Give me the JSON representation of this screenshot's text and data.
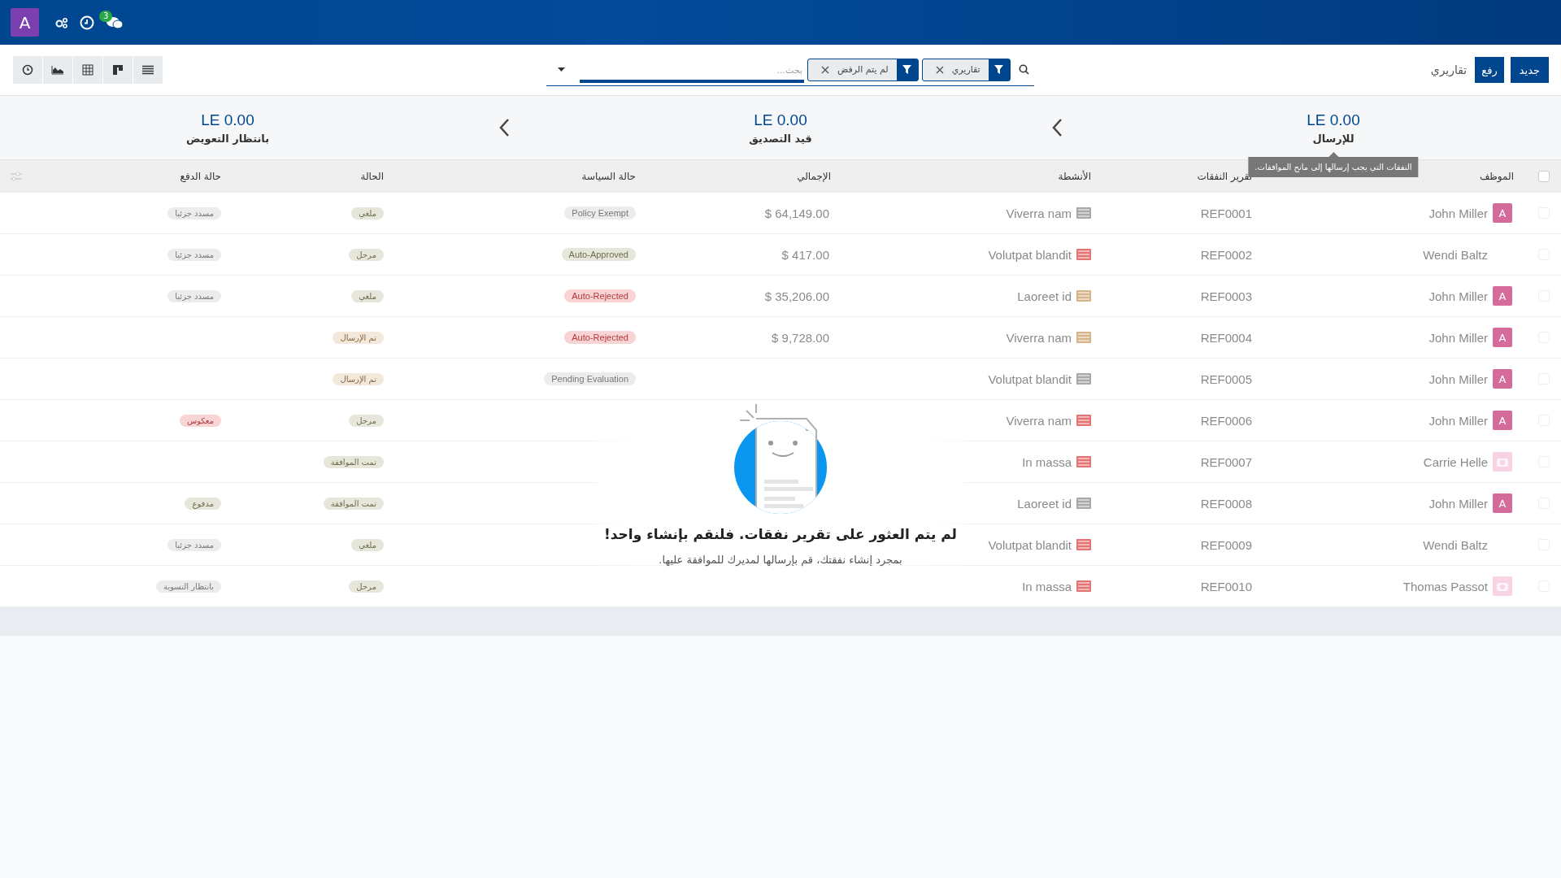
{
  "navbar": {
    "user_initial": "A",
    "messages_badge": "3"
  },
  "control_panel": {
    "buttons": [
      {
        "label": "جديد",
        "kind": "primary"
      },
      {
        "label": "رفع",
        "kind": "upload"
      }
    ],
    "breadcrumb": "تقاريري",
    "search": {
      "facets": [
        {
          "label": "تقاريري"
        },
        {
          "label": "لم يتم الرفض"
        }
      ],
      "placeholder": "بحث..."
    },
    "views": [
      {
        "kind": "activity"
      },
      {
        "kind": "graph"
      },
      {
        "kind": "pivot"
      },
      {
        "kind": "kanban"
      },
      {
        "kind": "list"
      }
    ]
  },
  "summary": [
    {
      "amount": "LE 0.00",
      "label": "للإرسال",
      "tooltip": "النفقات التي يجب إرسالها إلى مانح الموافقات."
    },
    {
      "amount": "LE 0.00",
      "label": "قيد التصديق"
    },
    {
      "amount": "LE 0.00",
      "label": "بانتظار التعويض"
    }
  ],
  "table": {
    "select_all_checked": false,
    "columns": [
      "الموظف",
      "تقرير النفقات",
      "الأنشطة",
      "الإجمالي",
      "حالة السياسة",
      "الحالة",
      "حالة الدفع"
    ],
    "rows": [
      {
        "checked": false,
        "employee": "John Miller",
        "avatar": {
          "kind": "letter",
          "text": "A"
        },
        "reference": "REF0001",
        "activity": "Viverra nam",
        "color": "#a8a8a8",
        "total": "$ 64,149.00",
        "policy": {
          "label": "Policy Exempt",
          "kind": "neutral"
        },
        "status": {
          "label": "ملغي",
          "kind": "olive"
        },
        "payment": {
          "label": "مسدد جزئيا",
          "kind": "neutral"
        }
      },
      {
        "checked": false,
        "employee": "Wendi Baltz",
        "avatar": {
          "kind": "none"
        },
        "reference": "REF0002",
        "activity": "Volutpat blandit",
        "color": "#e57373",
        "total": "$ 417.00",
        "policy": {
          "label": "Auto-Approved",
          "kind": "olive"
        },
        "status": {
          "label": "مرحل",
          "kind": "olive"
        },
        "payment": {
          "label": "مسدد جزئيا",
          "kind": "neutral"
        }
      },
      {
        "checked": false,
        "employee": "John Miller",
        "avatar": {
          "kind": "letter",
          "text": "A"
        },
        "reference": "REF0003",
        "activity": "Laoreet id",
        "color": "#d6b48a",
        "total": "$ 35,206.00",
        "policy": {
          "label": "Auto-Rejected",
          "kind": "red"
        },
        "status": {
          "label": "ملغي",
          "kind": "olive"
        },
        "payment": {
          "label": "مسدد جزئيا",
          "kind": "neutral"
        }
      },
      {
        "checked": false,
        "employee": "John Miller",
        "avatar": {
          "kind": "letter",
          "text": "A"
        },
        "reference": "REF0004",
        "activity": "Viverra nam",
        "color": "#d6b48a",
        "total": "$ 9,728.00",
        "policy": {
          "label": "Auto-Rejected",
          "kind": "red"
        },
        "status": {
          "label": "تم الإرسال",
          "kind": "tan"
        }
      },
      {
        "checked": false,
        "employee": "John Miller",
        "avatar": {
          "kind": "letter",
          "text": "A"
        },
        "reference": "REF0005",
        "activity": "Volutpat blandit",
        "color": "#a8a8a8",
        "policy": {
          "label": "Pending Evaluation",
          "kind": "neutral"
        },
        "status": {
          "label": "تم الإرسال",
          "kind": "tan"
        }
      },
      {
        "checked": false,
        "employee": "John Miller",
        "avatar": {
          "kind": "letter",
          "text": "A"
        },
        "reference": "REF0006",
        "activity": "Viverra nam",
        "color": "#e57373",
        "status": {
          "label": "مرحل",
          "kind": "olive"
        },
        "payment": {
          "label": "معكوس",
          "kind": "red"
        }
      },
      {
        "checked": false,
        "employee": "Carrie Helle",
        "avatar": {
          "kind": "placeholder"
        },
        "reference": "REF0007",
        "activity": "In massa",
        "color": "#e57373",
        "status": {
          "label": "تمت الموافقة",
          "kind": "olive"
        }
      },
      {
        "checked": false,
        "employee": "John Miller",
        "avatar": {
          "kind": "letter",
          "text": "A"
        },
        "reference": "REF0008",
        "activity": "Laoreet id",
        "color": "#a8a8a8",
        "status": {
          "label": "تمت الموافقة",
          "kind": "olive"
        },
        "payment": {
          "label": "مدفوع",
          "kind": "olive"
        }
      },
      {
        "checked": false,
        "employee": "Wendi Baltz",
        "avatar": {
          "kind": "none"
        },
        "reference": "REF0009",
        "activity": "Volutpat blandit",
        "color": "#e57373",
        "status": {
          "label": "ملغي",
          "kind": "olive"
        },
        "payment": {
          "label": "مسدد جزئيا",
          "kind": "neutral"
        }
      },
      {
        "checked": false,
        "employee": "Thomas Passot",
        "avatar": {
          "kind": "placeholder"
        },
        "reference": "REF0010",
        "activity": "In massa",
        "color": "#e57373",
        "status": {
          "label": "مرحل",
          "kind": "olive"
        },
        "payment": {
          "label": "بانتظار التسوية",
          "kind": "neutral"
        }
      }
    ]
  },
  "empty_state": {
    "title": "لم يتم العثور على تقرير نفقات. فلنقم بإنشاء واحد!",
    "text": "بمجرد إنشاء نفقتك، قم بإرسالها لمديرك للموافقة عليها."
  }
}
